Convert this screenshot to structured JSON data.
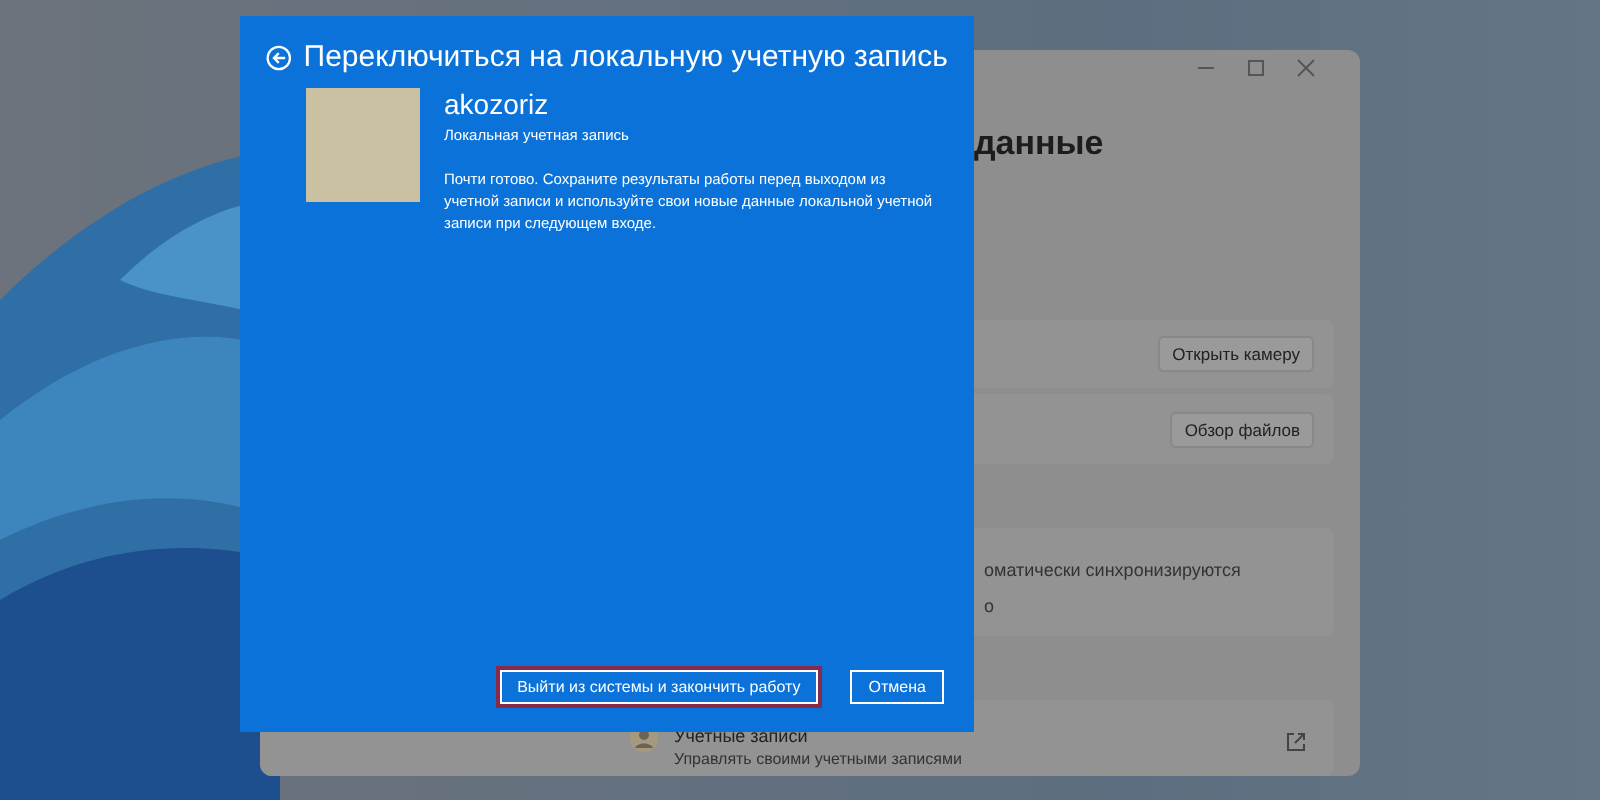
{
  "background_window": {
    "heading": "данные",
    "rows": [
      {
        "kind": "button",
        "button": "Открыть камеру"
      },
      {
        "kind": "button",
        "button": "Обзор файлов"
      },
      {
        "kind": "text",
        "lines": [
          "оматически синхронизируются",
          "о"
        ]
      },
      {
        "kind": "link",
        "title": "Учетные записи",
        "subtitle": "Управлять своими учетными записями"
      }
    ]
  },
  "dialog": {
    "title": "Переключиться на локальную учетную запись",
    "account": {
      "name": "akozoriz",
      "type": "Локальная учетная запись"
    },
    "message": "Почти готово. Сохраните результаты работы перед выходом из учетной записи и используйте свои новые данные локальной учетной записи при следующем входе.",
    "buttons": [
      {
        "label": "Выйти из системы и закончить работу",
        "focused": true
      },
      {
        "label": "Отмена",
        "focused": false
      }
    ]
  }
}
